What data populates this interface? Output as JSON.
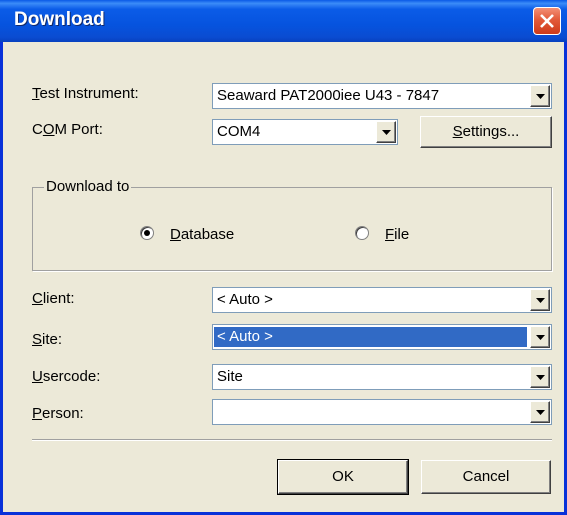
{
  "window": {
    "title": "Download"
  },
  "fields": {
    "test_instrument": {
      "label": "Test Instrument:",
      "value": "Seaward PAT2000iee U43 - 7847"
    },
    "com_port": {
      "label": "COM Port:",
      "value": "COM4"
    },
    "client": {
      "label": "Client:",
      "value": "< Auto >"
    },
    "site": {
      "label": "Site:",
      "value": "< Auto >"
    },
    "usercode": {
      "label": "Usercode:",
      "value": "Site"
    },
    "person": {
      "label": "Person:",
      "value": ""
    }
  },
  "settings_button": "Settings...",
  "download_to": {
    "legend": "Download to",
    "options": [
      {
        "label": "Database",
        "selected": true
      },
      {
        "label": "File",
        "selected": false
      }
    ]
  },
  "buttons": {
    "ok": "OK",
    "cancel": "Cancel"
  }
}
